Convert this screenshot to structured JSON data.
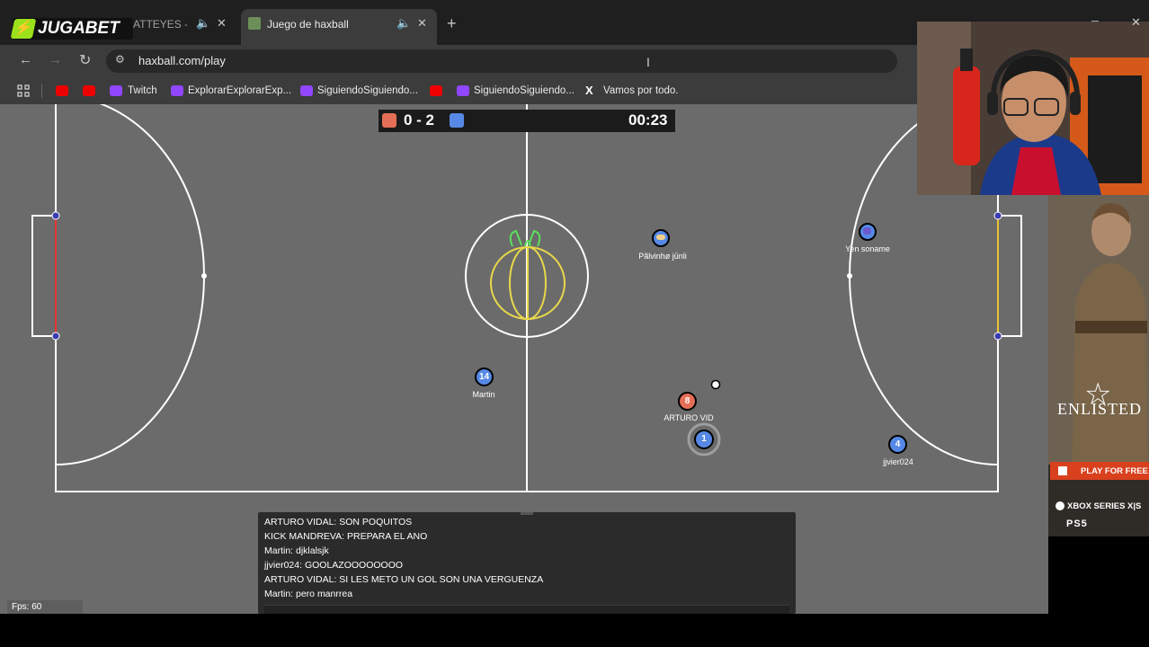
{
  "browser": {
    "inactive_tab_label": "ATTEYES - TC",
    "active_tab_label": "Juego de haxball",
    "url": "haxball.com/play",
    "bookmarks": [
      {
        "label": "Twitch",
        "icon": "twitch-icon"
      },
      {
        "label": "ExplorarExplorarExp...",
        "icon": "twitch-icon"
      },
      {
        "label": "SiguiendoSiguiendo...",
        "icon": "twitch-icon"
      },
      {
        "label": "SiguiendoSiguiendo...",
        "icon": "twitch-icon"
      },
      {
        "label": "Vamos por todo.",
        "icon": "x-icon"
      }
    ]
  },
  "overlay_logo": {
    "part1": "JUGA",
    "part2": "BET"
  },
  "scoreboard": {
    "red_score": "0",
    "separator": "-",
    "blue_score": "2",
    "score_text": "0 - 2",
    "time": "00:23",
    "red_color": "#e56e56",
    "blue_color": "#5689e5"
  },
  "players": [
    {
      "number": "",
      "name": "Pãlvinhø jūnli",
      "team": "blue"
    },
    {
      "number": "",
      "name": "Yen soname",
      "team": "blue"
    },
    {
      "number": "14",
      "name": "Martin",
      "team": "blue"
    },
    {
      "number": "8",
      "name": "ARTURO VID",
      "team": "red"
    },
    {
      "number": "1",
      "name": "",
      "team": "blue"
    },
    {
      "number": "4",
      "name": "jjvier024",
      "team": "blue"
    }
  ],
  "chat": [
    "ARTURO VIDAL: SON POQUITOS",
    "KICK MANDREVA: PREPARA EL ANO",
    "Martin: djklalsjk",
    "jjvier024: GOOLAZOOOOOOOO",
    "ARTURO VIDAL: SI LES METO UN GOL SON UNA VERGUENZA",
    "Martin: pero manrrea"
  ],
  "fps": "Fps: 60",
  "ad": {
    "title": "ENLISTED",
    "cta": "PLAY FOR FREE",
    "platforms": "XBOX SERIES X|S",
    "ps": "PS5"
  }
}
